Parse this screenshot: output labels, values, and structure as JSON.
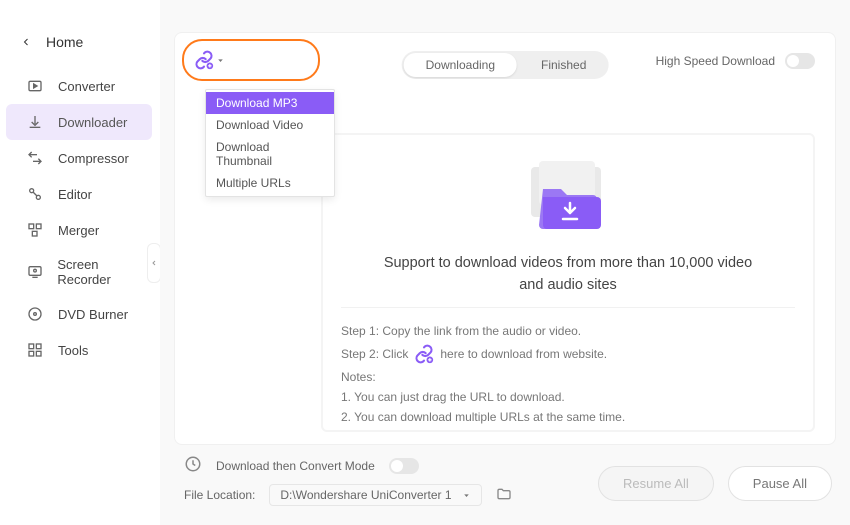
{
  "titlebar": {},
  "home_label": "Home",
  "sidebar": {
    "items": [
      {
        "label": "Converter"
      },
      {
        "label": "Downloader"
      },
      {
        "label": "Compressor"
      },
      {
        "label": "Editor"
      },
      {
        "label": "Merger"
      },
      {
        "label": "Screen Recorder"
      },
      {
        "label": "DVD Burner"
      },
      {
        "label": "Tools"
      }
    ]
  },
  "dropdown": {
    "items": [
      {
        "label": "Download MP3"
      },
      {
        "label": "Download Video"
      },
      {
        "label": "Download Thumbnail"
      },
      {
        "label": "Multiple URLs"
      }
    ]
  },
  "tabs": {
    "downloading": "Downloading",
    "finished": "Finished"
  },
  "high_speed_label": "High Speed Download",
  "content": {
    "headline": "Support to download videos from more than 10,000 video and audio sites",
    "step1": "Step 1: Copy the link from the audio or video.",
    "step2a": "Step 2: Click",
    "step2b": "here to download from website.",
    "notes_label": "Notes:",
    "note1": "1. You can just drag the URL to download.",
    "note2": "2. You can download multiple URLs at the same time."
  },
  "footer": {
    "mode_label": "Download then Convert Mode",
    "location_label": "File Location:",
    "location_value": "D:\\Wondershare UniConverter 1",
    "resume": "Resume All",
    "pause": "Pause All"
  }
}
